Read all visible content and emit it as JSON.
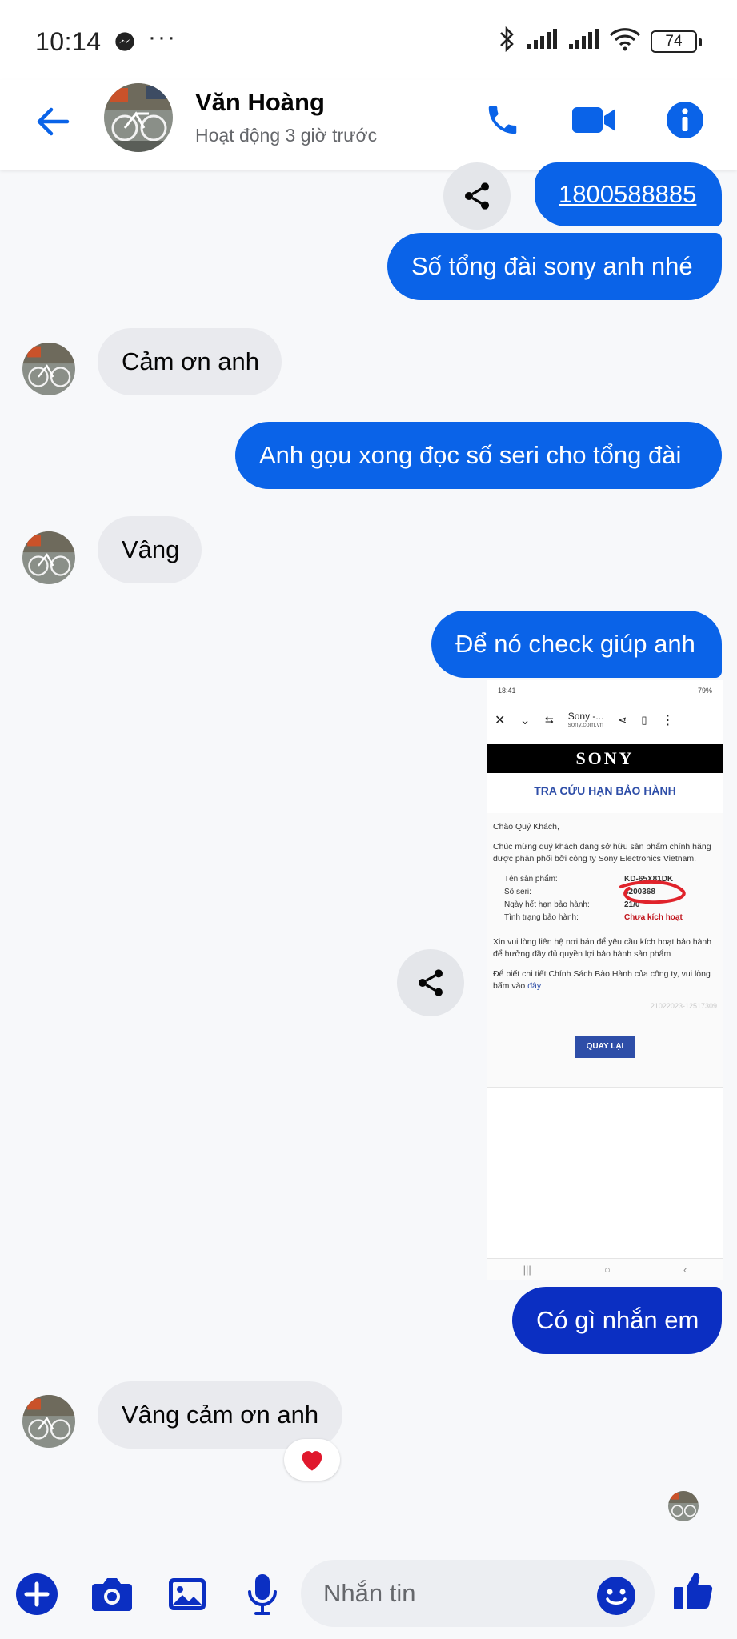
{
  "status_bar": {
    "time": "10:14",
    "more": "···",
    "battery": "74"
  },
  "header": {
    "name": "Văn Hoàng",
    "status": "Hoạt động 3 giờ trước"
  },
  "messages": {
    "phone_link": "1800588885",
    "out1": "Số tổng đài sony anh nhé",
    "in1": "Cảm ơn anh",
    "out2": "Anh gọu xong đọc số seri cho tổng đài",
    "in2": "Vâng",
    "out3": "Để nó check giúp anh",
    "out4": "Có gì nhắn em",
    "in3": "Vâng cảm ơn anh"
  },
  "shared_screenshot": {
    "status_time": "18:41",
    "status_right": "79%",
    "tab_title": "Sony -...",
    "tab_url": "sony.com.vn",
    "brand": "SONY",
    "heading": "TRA CỨU HẠN BẢO HÀNH",
    "greeting": "Chào Quý Khách,",
    "intro": "Chúc mừng quý khách đang sở hữu sản phẩm chính hãng được phân phối bởi công ty Sony Electronics Vietnam.",
    "rows": [
      {
        "label": "Tên sản phẩm:",
        "value": "KD-65X81DK"
      },
      {
        "label": "Số seri:",
        "value": "4200368"
      },
      {
        "label": "Ngày hết hạn bảo hành:",
        "value": "21/0"
      },
      {
        "label": "Tình trạng bảo hành:",
        "value": "Chưa kích hoạt"
      }
    ],
    "contact_note": "Xin vui lòng liên hệ nơi bán để yêu cầu kích hoạt bảo hành để hưởng đầy đủ quyền lợi bảo hành sản phẩm",
    "policy_note": "Để biết chi tiết Chính Sách Bảo Hành của công ty, vui lòng bấm vào",
    "policy_link": "đây",
    "ref_id": "21022023-12517309",
    "back_button": "QUAY LẠI"
  },
  "composer": {
    "placeholder": "Nhắn tin"
  },
  "colors": {
    "accent": "#0a63e8",
    "dark_bubble": "#0b2fc2",
    "incoming": "#e9eaee",
    "heart": "#e0182d"
  }
}
